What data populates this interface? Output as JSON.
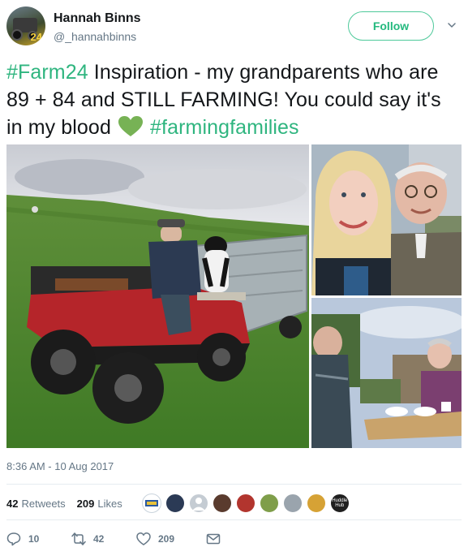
{
  "user": {
    "display_name": "Hannah Binns",
    "handle": "@_hannahbinns",
    "avatar_text": "24",
    "follow_label": "Follow"
  },
  "tweet": {
    "hashtag_1": "#Farm24",
    "text_1": " Inspiration - my grandparents who are 89 + 84 and STILL FARMING! You could say it's in my blood ",
    "hashtag_2": "#farmingfamilies",
    "emoji": "green-heart-icon"
  },
  "timestamp": "8:36 AM - 10 Aug 2017",
  "stats": {
    "retweets_count": "42",
    "retweets_label": "Retweets",
    "likes_count": "209",
    "likes_label": "Likes",
    "liker_avatar_texts": [
      "Huddle Hub"
    ]
  },
  "actions": {
    "replies": "10",
    "retweets": "42",
    "likes": "209"
  },
  "colors": {
    "accent": "#2fb57f",
    "follow_border": "#4ec99a",
    "muted": "#657786",
    "text": "#14171a"
  }
}
